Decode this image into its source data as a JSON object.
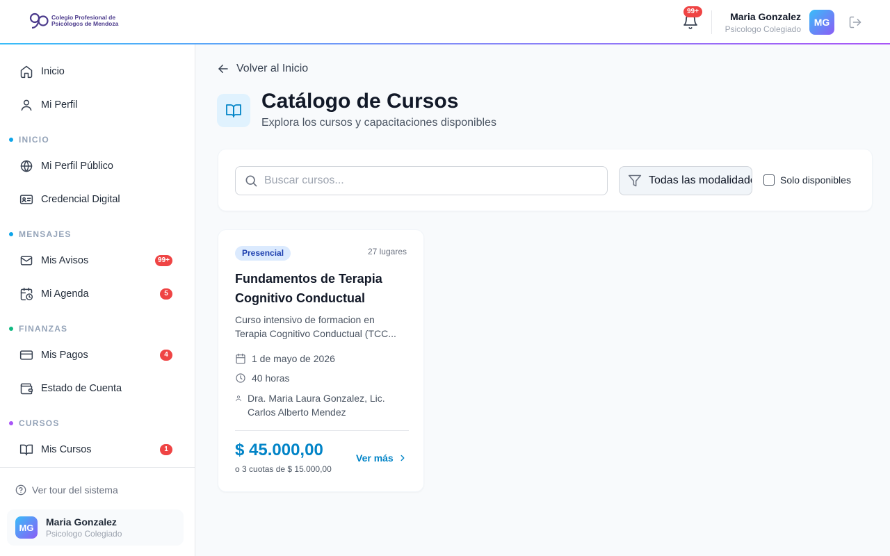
{
  "header": {
    "logo_text_line1": "Colegio Profesional de",
    "logo_text_line2": "Psicólogos de Mendoza",
    "notifications_badge": "99+",
    "user_name": "Maria Gonzalez",
    "user_role": "Psicologo Colegiado",
    "avatar_initials": "MG"
  },
  "sidebar": {
    "items": [
      {
        "label": "Inicio",
        "icon": "home-icon"
      },
      {
        "label": "Mi Perfil",
        "icon": "user-icon"
      },
      {
        "label": "Mi Perfil Público",
        "icon": "globe-icon"
      },
      {
        "label": "Credencial Digital",
        "icon": "id-card-icon"
      },
      {
        "label": "Mis Avisos",
        "icon": "mail-icon",
        "badge": "99+"
      },
      {
        "label": "Mi Agenda",
        "icon": "calendar-clock-icon",
        "badge": "5"
      },
      {
        "label": "Mis Pagos",
        "icon": "credit-card-icon",
        "badge": "4"
      },
      {
        "label": "Estado de Cuenta",
        "icon": "wallet-icon"
      },
      {
        "label": "Mis Cursos",
        "icon": "book-icon",
        "badge": "1"
      }
    ],
    "sections": [
      {
        "title": "INICIO",
        "color": "#0ea5e9"
      },
      {
        "title": "MENSAJES",
        "color": "#0ea5e9"
      },
      {
        "title": "FINANZAS",
        "color": "#10b981"
      },
      {
        "title": "CURSOS",
        "color": "#a855f7"
      }
    ],
    "tour_label": "Ver tour del sistema",
    "user_name": "Maria Gonzalez",
    "user_role": "Psicologo Colegiado",
    "avatar_initials": "MG"
  },
  "main": {
    "back_label": "Volver al Inicio",
    "title": "Catálogo de Cursos",
    "subtitle": "Explora los cursos y capacitaciones disponibles",
    "search_placeholder": "Buscar cursos...",
    "modality_selected": "Todas las modalidades",
    "only_available_label": "Solo disponibles",
    "only_available_checked": false
  },
  "courses": [
    {
      "modality": "Presencial",
      "places": "27 lugares",
      "title": "Fundamentos de Terapia Cognitivo Conductual",
      "description": "Curso intensivo de formacion en Terapia Cognitivo Conductual (TCC...",
      "date": "1 de mayo de 2026",
      "hours": "40 horas",
      "instructors": "Dra. Maria Laura Gonzalez, Lic. Carlos Alberto Mendez",
      "price": "$ 45.000,00",
      "installments": "o 3 cuotas de $ 15.000,00",
      "more_label": "Ver más"
    }
  ],
  "colors": {
    "accent": "#0284c7",
    "badge": "#ef4444",
    "tag_bg": "#dbeafe"
  }
}
